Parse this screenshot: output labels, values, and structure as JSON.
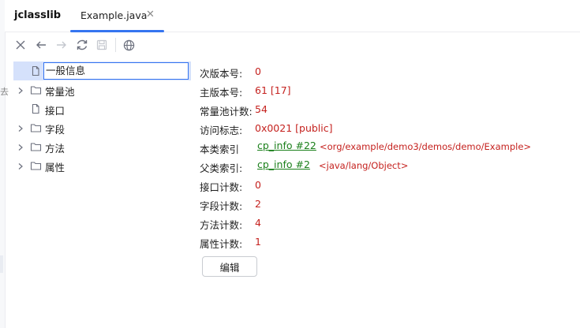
{
  "app": {
    "title": "jclasslib"
  },
  "tabs": [
    {
      "label": "Example.java",
      "close_icon": "close-icon"
    }
  ],
  "toolbar": {
    "buttons": [
      {
        "name": "close-icon",
        "enabled": true
      },
      {
        "name": "back-arrow-icon",
        "enabled": true
      },
      {
        "name": "forward-arrow-icon",
        "enabled": false
      },
      {
        "name": "refresh-icon",
        "enabled": true
      },
      {
        "name": "save-icon",
        "enabled": false
      },
      {
        "name": "globe-icon",
        "enabled": true
      }
    ]
  },
  "tree": {
    "items": [
      {
        "label": "一般信息",
        "expandable": false,
        "icon": "file-icon",
        "selected": true
      },
      {
        "label": "常量池",
        "expandable": true,
        "icon": "folder-icon"
      },
      {
        "label": "接口",
        "expandable": false,
        "icon": "file-icon"
      },
      {
        "label": "字段",
        "expandable": true,
        "icon": "folder-icon"
      },
      {
        "label": "方法",
        "expandable": true,
        "icon": "folder-icon"
      },
      {
        "label": "属性",
        "expandable": true,
        "icon": "folder-icon"
      }
    ]
  },
  "details": {
    "minor_version": {
      "label": "次版本号:",
      "value": "0"
    },
    "major_version": {
      "label": "主版本号:",
      "value": "61 [17]"
    },
    "constant_pool_count": {
      "label": "常量池计数:",
      "value": "54"
    },
    "access_flags": {
      "label": "访问标志:",
      "value": "0x0021 [public]"
    },
    "this_class": {
      "label": "本类索引",
      "link": "cp_info #22",
      "ref": "<org/example/demo3/demos/demo/Example>"
    },
    "super_class": {
      "label": "父类索引:",
      "link": "cp_info #2",
      "ref": "<java/lang/Object>"
    },
    "interfaces_count": {
      "label": "接口计数:",
      "value": "0"
    },
    "fields_count": {
      "label": "字段计数:",
      "value": "2"
    },
    "methods_count": {
      "label": "方法计数:",
      "value": "4"
    },
    "attributes_count": {
      "label": "属性计数:",
      "value": "1"
    },
    "edit_button": "编辑"
  },
  "colors": {
    "accent": "#3574f0",
    "value": "#c5221f",
    "link": "#1a7f1a",
    "selection": "#d5e1fb"
  }
}
